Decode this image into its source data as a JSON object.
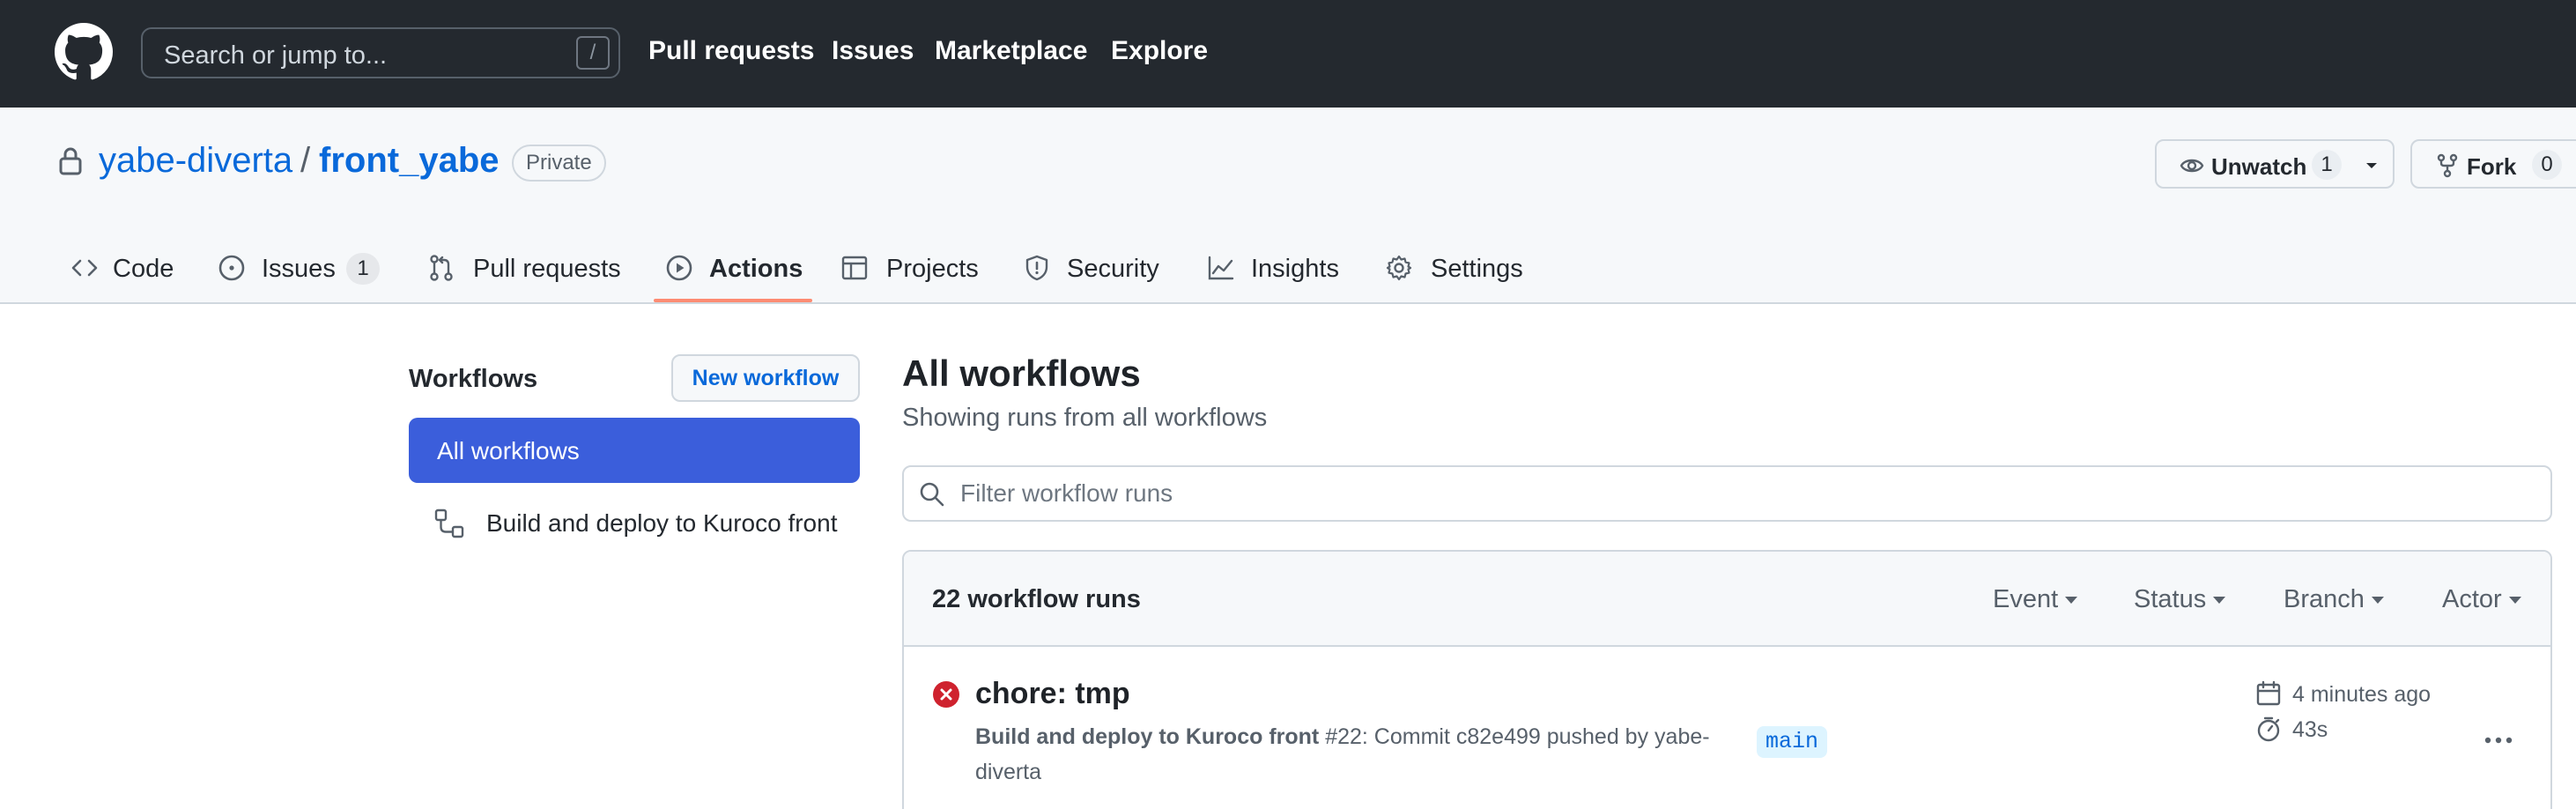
{
  "header": {
    "search_placeholder": "Search or jump to...",
    "search_shortcut": "/",
    "nav": [
      "Pull requests",
      "Issues",
      "Marketplace",
      "Explore"
    ]
  },
  "repo": {
    "owner": "yabe-diverta",
    "separator": "/",
    "name": "front_yabe",
    "visibility": "Private",
    "unwatch_label": "Unwatch",
    "watch_count": "1",
    "fork_label": "Fork",
    "fork_count": "0"
  },
  "tabs": [
    {
      "label": "Code",
      "icon": "code-icon"
    },
    {
      "label": "Issues",
      "icon": "issue-icon",
      "count": "1"
    },
    {
      "label": "Pull requests",
      "icon": "pull-request-icon"
    },
    {
      "label": "Actions",
      "icon": "play-icon",
      "active": true
    },
    {
      "label": "Projects",
      "icon": "table-icon"
    },
    {
      "label": "Security",
      "icon": "shield-icon"
    },
    {
      "label": "Insights",
      "icon": "graph-icon"
    },
    {
      "label": "Settings",
      "icon": "gear-icon"
    }
  ],
  "sidebar": {
    "title": "Workflows",
    "new_workflow_label": "New workflow",
    "all_workflows_label": "All workflows",
    "workflows": [
      "Build and deploy to Kuroco front"
    ]
  },
  "main": {
    "title": "All workflows",
    "subtitle": "Showing runs from all workflows",
    "filter_placeholder": "Filter workflow runs",
    "runs_count": "22 workflow runs",
    "filters": [
      "Event",
      "Status",
      "Branch",
      "Actor"
    ]
  },
  "runs": [
    {
      "title": "chore: tmp",
      "workflow": "Build and deploy to Kuroco front",
      "description": " #22: Commit c82e499 pushed by yabe-diverta",
      "branch": "main",
      "time_ago": "4 minutes ago",
      "duration": "43s",
      "status": "failure"
    }
  ],
  "colors": {
    "header_bg": "#24292f",
    "link": "#0969da",
    "active_tab_underline": "#fd8c73",
    "sidebar_active_bg": "#3b5edb",
    "failure": "#cf222e"
  }
}
